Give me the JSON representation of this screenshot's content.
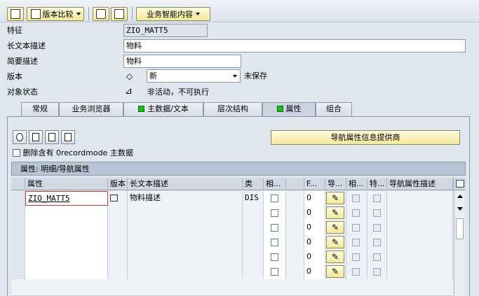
{
  "toolbar": {
    "version_compare_label": "版本比较",
    "business_content_label": "业务智能内容"
  },
  "form": {
    "feature_label": "特征",
    "feature_value": "ZIO_MATT5",
    "long_desc_label": "长文本描述",
    "long_desc_value": "物料",
    "short_desc_label": "简要描述",
    "short_desc_value": "物料",
    "version_label": "版本",
    "version_value": "新",
    "version_status": "未保存",
    "object_status_label": "对象状态",
    "object_status_value": "非活动，不可执行"
  },
  "tabs": [
    {
      "label": "常规"
    },
    {
      "label": "业务浏览器"
    },
    {
      "label": "主数据/文本"
    },
    {
      "label": "层次结构"
    },
    {
      "label": "属性"
    },
    {
      "label": "组合"
    }
  ],
  "panel": {
    "nav_provider_button": "导航属性信息提供商",
    "delete_checkbox_label": "删除含有 0recordmode 主数据"
  },
  "grid": {
    "title": "属性: 明细/导航属性",
    "columns": [
      "属性",
      "版本",
      "长文本描述",
      "类",
      "相...",
      "F...",
      "导...",
      "相...",
      "特...",
      "导航属性描述"
    ],
    "rows": [
      {
        "attribute": "ZIO_MATT5",
        "desc": "物料描述",
        "type": "DIS",
        "f": "0"
      },
      {
        "attribute": "",
        "desc": "",
        "type": "",
        "f": "0"
      },
      {
        "attribute": "",
        "desc": "",
        "type": "",
        "f": "0"
      },
      {
        "attribute": "",
        "desc": "",
        "type": "",
        "f": "0"
      },
      {
        "attribute": "",
        "desc": "",
        "type": "",
        "f": "0"
      },
      {
        "attribute": "",
        "desc": "",
        "type": "",
        "f": "0"
      }
    ]
  }
}
